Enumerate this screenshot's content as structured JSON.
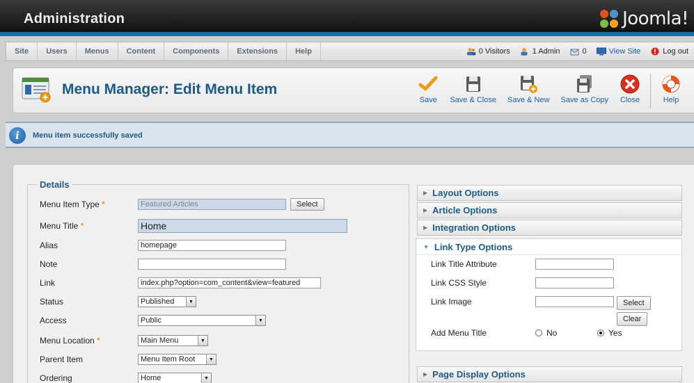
{
  "header": {
    "title": "Administration",
    "logo_text": "Joomla!"
  },
  "menubar": {
    "items": [
      "Site",
      "Users",
      "Menus",
      "Content",
      "Components",
      "Extensions",
      "Help"
    ]
  },
  "status": {
    "visitors": "0 Visitors",
    "admins": "1 Admin",
    "messages": "0",
    "view_site": "View Site",
    "logout": "Log out"
  },
  "page": {
    "title": "Menu Manager: Edit Menu Item"
  },
  "toolbar": {
    "save": "Save",
    "save_close": "Save & Close",
    "save_new": "Save & New",
    "save_copy": "Save as Copy",
    "close": "Close",
    "help": "Help"
  },
  "message": {
    "text": "Menu item successfully saved"
  },
  "details": {
    "legend": "Details",
    "required_mark": "*",
    "menu_item_type_label": "Menu Item Type",
    "menu_item_type_value": "Featured Articles",
    "select_label": "Select",
    "menu_title_label": "Menu Title",
    "menu_title_value": "Home",
    "alias_label": "Alias",
    "alias_value": "homepage",
    "note_label": "Note",
    "note_value": "",
    "link_label": "Link",
    "link_value": "index.php?option=com_content&view=featured",
    "status_label": "Status",
    "status_value": "Published",
    "access_label": "Access",
    "access_value": "Public",
    "menu_location_label": "Menu Location",
    "menu_location_value": "Main Menu",
    "parent_item_label": "Parent Item",
    "parent_item_value": "Menu Item Root",
    "ordering_label": "Ordering",
    "ordering_value": "Home"
  },
  "panels": {
    "layout": "Layout Options",
    "article": "Article Options",
    "integration": "Integration Options",
    "link_type": "Link Type Options",
    "page_display": "Page Display Options"
  },
  "link_type": {
    "title_attr_label": "Link Title Attribute",
    "css_style_label": "Link CSS Style",
    "image_label": "Link Image",
    "select_label": "Select",
    "clear_label": "Clear",
    "add_menu_title_label": "Add Menu Title",
    "no_label": "No",
    "yes_label": "Yes"
  }
}
